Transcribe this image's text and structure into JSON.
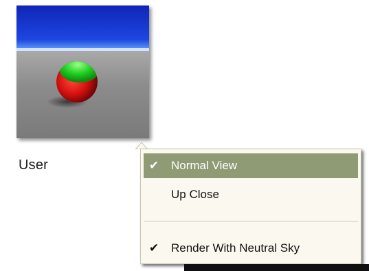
{
  "preset": {
    "label": "User",
    "sphere_top_color": "#1fdc1f",
    "sphere_bottom_color": "#d41010",
    "sky_color": "#1530c8",
    "ground_color": "#8a8a8a"
  },
  "menu": {
    "items": [
      {
        "label": "Normal View",
        "checked": true,
        "highlighted": true
      },
      {
        "label": "Up Close",
        "checked": false,
        "highlighted": false
      },
      {
        "label": "Render With Neutral Sky",
        "checked": true,
        "highlighted": false
      }
    ],
    "check_glyph": "✔",
    "highlight_color": "#8f9b75"
  },
  "icons": {
    "check": "checkmark-icon",
    "caret": "popup-caret-icon"
  }
}
